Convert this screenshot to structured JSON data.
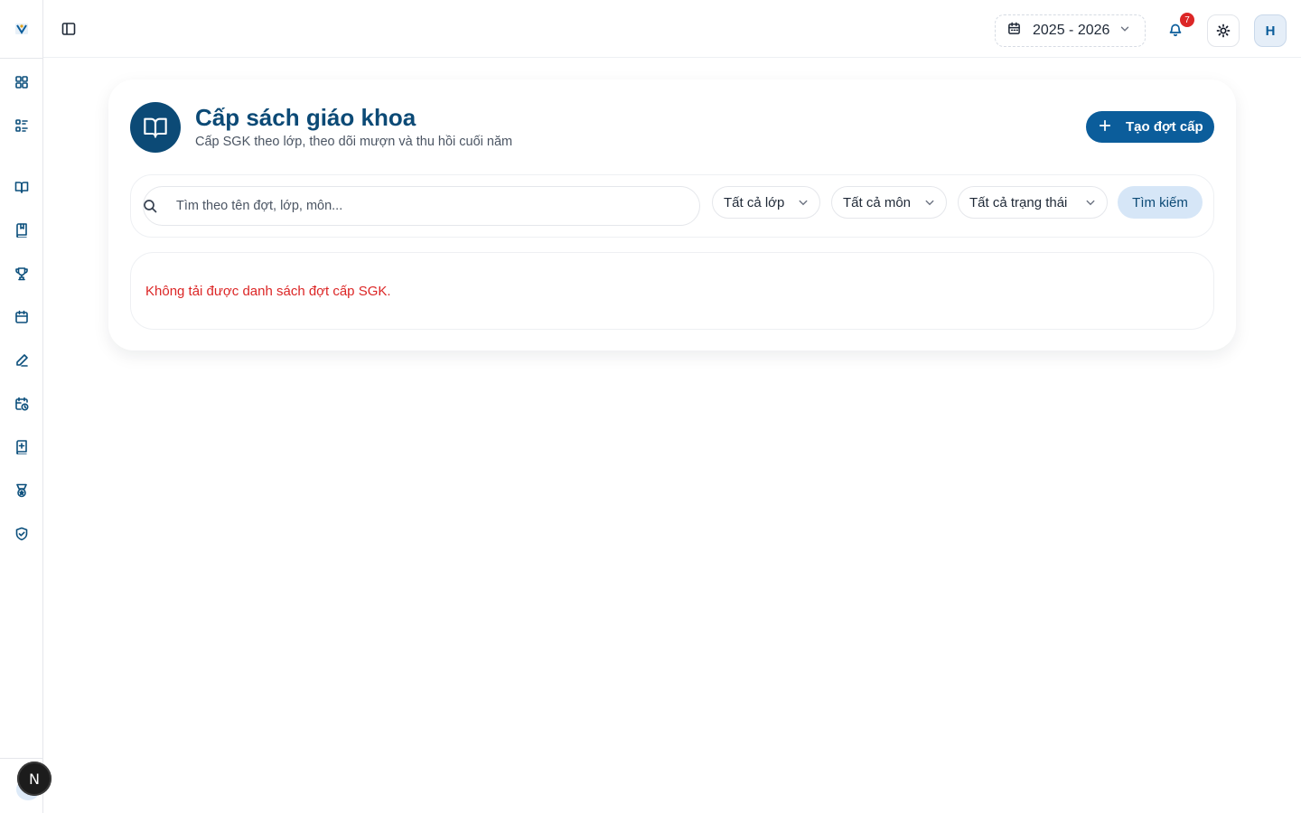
{
  "sidebar": {
    "logo_icon": "school-logo-icon",
    "items": [
      {
        "icon": "dashboard-icon"
      },
      {
        "icon": "list-icon"
      },
      {
        "icon": "book-open-icon"
      },
      {
        "icon": "bookmark-book-icon"
      },
      {
        "icon": "trophy-icon"
      },
      {
        "icon": "calendar-icon"
      },
      {
        "icon": "pen-icon"
      },
      {
        "icon": "calendar-clock-icon"
      },
      {
        "icon": "book-plus-icon"
      },
      {
        "icon": "medal-icon"
      },
      {
        "icon": "shield-check-icon"
      }
    ],
    "dev_badge": "N"
  },
  "topbar": {
    "year": "2025 - 2026",
    "notification_count": "7",
    "avatar_initial": "H"
  },
  "header": {
    "title": "Cấp sách giáo khoa",
    "subtitle": "Cấp SGK theo lớp, theo dõi mượn và thu hồi cuối năm",
    "create_label": "Tạo đợt cấp"
  },
  "filters": {
    "search_placeholder": "Tìm theo tên đợt, lớp, môn...",
    "class_select": "Tất cả lớp",
    "subject_select": "Tất cả môn",
    "status_select": "Tất cả trạng thái",
    "search_button": "Tìm kiếm"
  },
  "error": {
    "message": "Không tải được danh sách đợt cấp SGK."
  },
  "colors": {
    "primary": "#0b5d9b",
    "primary_dark": "#0c4a76",
    "error": "#dc2626",
    "badge": "#dc2626"
  }
}
